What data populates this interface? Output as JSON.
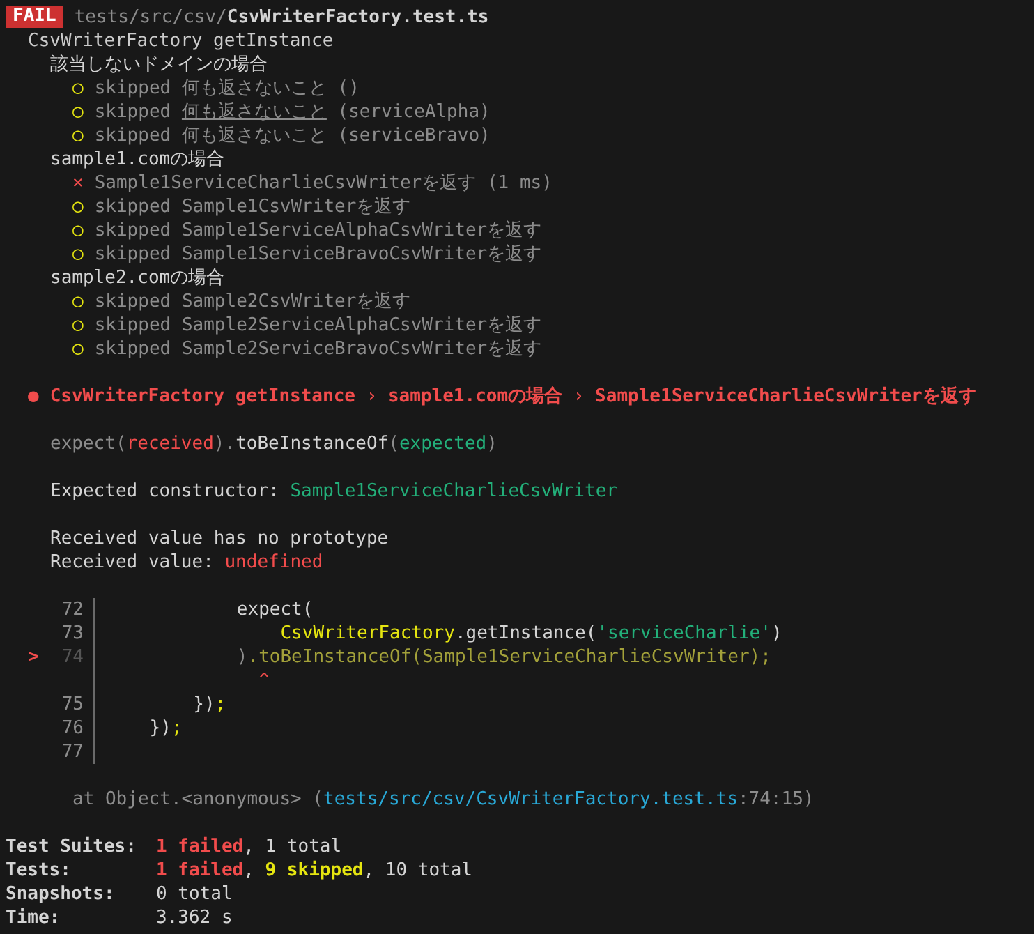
{
  "header": {
    "badge": "FAIL",
    "dir": "tests/src/csv/",
    "file": "CsvWriterFactory.test.ts"
  },
  "suite": {
    "title": "CsvWriterFactory getInstance",
    "groups": [
      {
        "title": "該当しないドメインの場合",
        "tests": [
          {
            "kind": "skipped",
            "icon": "○",
            "label": "skipped",
            "name": "何も返さないこと",
            "suffix": "()",
            "underlined": false
          },
          {
            "kind": "skipped",
            "icon": "○",
            "label": "skipped",
            "name": "何も返さないこと",
            "suffix": "(serviceAlpha)",
            "underlined": true
          },
          {
            "kind": "skipped",
            "icon": "○",
            "label": "skipped",
            "name": "何も返さないこと",
            "suffix": "(serviceBravo)",
            "underlined": false
          }
        ]
      },
      {
        "title": "sample1.comの場合",
        "tests": [
          {
            "kind": "failed",
            "icon": "×",
            "name": "Sample1ServiceCharlieCsvWriterを返す",
            "suffix": "(1 ms)",
            "underlined": false
          },
          {
            "kind": "skipped",
            "icon": "○",
            "label": "skipped",
            "name": "Sample1CsvWriterを返す",
            "underlined": false
          },
          {
            "kind": "skipped",
            "icon": "○",
            "label": "skipped",
            "name": "Sample1ServiceAlphaCsvWriterを返す",
            "underlined": false
          },
          {
            "kind": "skipped",
            "icon": "○",
            "label": "skipped",
            "name": "Sample1ServiceBravoCsvWriterを返す",
            "underlined": false
          }
        ]
      },
      {
        "title": "sample2.comの場合",
        "tests": [
          {
            "kind": "skipped",
            "icon": "○",
            "label": "skipped",
            "name": "Sample2CsvWriterを返す",
            "underlined": false
          },
          {
            "kind": "skipped",
            "icon": "○",
            "label": "skipped",
            "name": "Sample2ServiceAlphaCsvWriterを返す",
            "underlined": false
          },
          {
            "kind": "skipped",
            "icon": "○",
            "label": "skipped",
            "name": "Sample2ServiceBravoCsvWriterを返す",
            "underlined": false
          }
        ]
      }
    ]
  },
  "failure": {
    "bullet": "●",
    "title": [
      {
        "text": "CsvWriterFactory getInstance",
        "kind": "crumb"
      },
      {
        "text": "›",
        "kind": "separator"
      },
      {
        "text": "sample1.comの場合",
        "kind": "crumb"
      },
      {
        "text": "›",
        "kind": "separator"
      },
      {
        "text": "Sample1ServiceCharlieCsvWriterを返す",
        "kind": "crumb"
      }
    ],
    "message": [
      [
        {
          "segments": [
            {
              "text": "expect(",
              "kind": "dim"
            },
            {
              "text": "received",
              "kind": "red"
            },
            {
              "text": ").",
              "kind": "dim"
            },
            {
              "text": "toBeInstanceOf",
              "kind": "plain"
            },
            {
              "text": "(",
              "kind": "dim"
            },
            {
              "text": "expected",
              "kind": "green"
            },
            {
              "text": ")",
              "kind": "dim"
            }
          ]
        }
      ],
      [
        {
          "segments": [
            {
              "text": "Expected constructor: ",
              "kind": "plain"
            },
            {
              "text": "Sample1ServiceCharlieCsvWriter",
              "kind": "green"
            }
          ]
        }
      ],
      [
        {
          "segments": [
            {
              "text": "Received value has no prototype",
              "kind": "plain"
            }
          ]
        },
        {
          "segments": [
            {
              "text": "Received value: ",
              "kind": "plain"
            },
            {
              "text": "undefined",
              "kind": "red"
            }
          ]
        }
      ]
    ],
    "code_frame": [
      {
        "number": "72",
        "current": false,
        "code": [
          {
            "text": "            expect(",
            "kind": "plain"
          }
        ]
      },
      {
        "number": "73",
        "current": false,
        "code": [
          {
            "text": "                CsvWriterFactory",
            "kind": "yellow"
          },
          {
            "text": ".getInstance(",
            "kind": "plain"
          },
          {
            "text": "'serviceCharlie'",
            "kind": "green"
          },
          {
            "text": ")",
            "kind": "plain"
          }
        ]
      },
      {
        "number": "74",
        "marker": ">",
        "current": true,
        "code": [
          {
            "text": "            )",
            "kind": "dim"
          },
          {
            "text": ".toBeInstanceOf(Sample1ServiceCharlieCsvWriter);",
            "kind": "olive"
          }
        ]
      },
      {
        "code": [
          {
            "text": "              ^",
            "kind": "red"
          }
        ]
      },
      {
        "number": "75",
        "current": false,
        "code": [
          {
            "text": "        })",
            "kind": "plain"
          },
          {
            "text": ";",
            "kind": "yellow"
          }
        ]
      },
      {
        "number": "76",
        "current": false,
        "code": [
          {
            "text": "    })",
            "kind": "plain"
          },
          {
            "text": ";",
            "kind": "yellow"
          }
        ]
      },
      {
        "number": "77",
        "current": false
      }
    ],
    "location": [
      {
        "text": "at Object.<anonymous> (",
        "kind": "dim"
      },
      {
        "text": "tests/src/csv/CsvWriterFactory.test.ts",
        "kind": "cyan"
      },
      {
        "text": ":74:15)",
        "kind": "dim"
      }
    ]
  },
  "summary": [
    {
      "label": "Test Suites:",
      "parts": [
        {
          "text": "1 failed",
          "kind": "redbold"
        },
        {
          "text": ", 1 total",
          "kind": "plain"
        }
      ]
    },
    {
      "label": "Tests:",
      "parts": [
        {
          "text": "1 failed",
          "kind": "redbold"
        },
        {
          "text": ", ",
          "kind": "plain"
        },
        {
          "text": "9 skipped",
          "kind": "yellowbold"
        },
        {
          "text": ", 10 total",
          "kind": "plain"
        }
      ]
    },
    {
      "label": "Snapshots:",
      "parts": [
        {
          "text": "0 total",
          "kind": "plain"
        }
      ]
    },
    {
      "label": "Time:",
      "parts": [
        {
          "text": "3.362 s",
          "kind": "plain"
        }
      ]
    }
  ]
}
